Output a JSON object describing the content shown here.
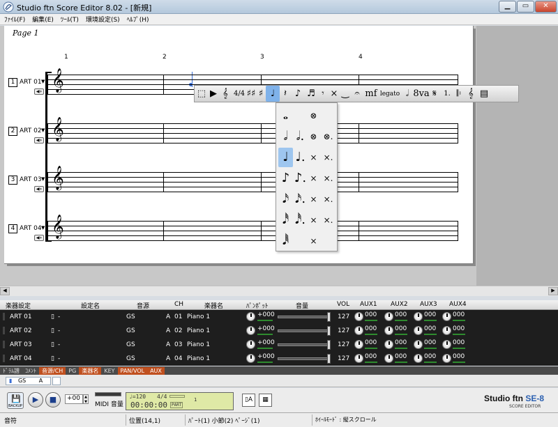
{
  "window": {
    "title": "Studio ftn Score Editor 8.02 - [新規]"
  },
  "menu": [
    "ﾌｧｲﾙ(F)",
    "編集(E)",
    "ﾂｰﾙ(T)",
    "環境設定(S)",
    "ﾍﾙﾌﾟ(H)"
  ],
  "score": {
    "page_label": "Page 1",
    "measures": [
      "1",
      "2",
      "3",
      "4"
    ],
    "tracks": [
      {
        "num": "1",
        "name": "ART 01"
      },
      {
        "num": "2",
        "name": "ART 02"
      },
      {
        "num": "3",
        "name": "ART 03"
      },
      {
        "num": "4",
        "name": "ART 04"
      }
    ]
  },
  "toolbar": {
    "tools": [
      {
        "name": "select-tool",
        "glyph": "⬚"
      },
      {
        "name": "play-tool",
        "glyph": "▶"
      },
      {
        "name": "clef-tool",
        "glyph": "𝄞"
      },
      {
        "name": "time-signature-tool",
        "glyph": "4/4"
      },
      {
        "name": "key-signature-tool",
        "glyph": "♯♯"
      },
      {
        "name": "accidental-tool",
        "glyph": "♯"
      },
      {
        "name": "note-tool",
        "glyph": "♩"
      },
      {
        "name": "rest-tool",
        "glyph": "𝄽"
      },
      {
        "name": "tuplet-tool",
        "glyph": "♪"
      },
      {
        "name": "tuplet-rest-tool",
        "glyph": "♬"
      },
      {
        "name": "grace-tool",
        "glyph": "𝄾"
      },
      {
        "name": "drum-tool",
        "glyph": "×"
      },
      {
        "name": "tie-tool",
        "glyph": "‿"
      },
      {
        "name": "fermata-tool",
        "glyph": "𝄐"
      },
      {
        "name": "dynamics-tool",
        "glyph": "mf"
      },
      {
        "name": "legato-tool",
        "glyph": "legato"
      },
      {
        "name": "repeat-dot-tool",
        "glyph": "𝅗𝅥"
      },
      {
        "name": "octave-tool",
        "glyph": "8va"
      },
      {
        "name": "segno-tool",
        "glyph": "𝄋"
      },
      {
        "name": "volta-tool",
        "glyph": "1."
      },
      {
        "name": "repeat-tool",
        "glyph": "𝄆"
      },
      {
        "name": "staff-tool",
        "glyph": "𝄞"
      },
      {
        "name": "layout-tool",
        "glyph": "▤"
      }
    ],
    "selected_tool": "note-tool"
  },
  "note_palette": {
    "rows": [
      [
        "𝅝",
        "",
        "⊗",
        ""
      ],
      [
        "𝅗𝅥",
        "𝅗𝅥.",
        "⊗",
        "⊗."
      ],
      [
        "♩",
        "♩.",
        "×",
        "×."
      ],
      [
        "♪",
        "♪.",
        "×",
        "×."
      ],
      [
        "𝅘𝅥𝅯",
        "𝅘𝅥𝅯.",
        "×",
        "×."
      ],
      [
        "𝅘𝅥𝅰",
        "𝅘𝅥𝅰.",
        "×",
        "×."
      ],
      [
        "𝅘𝅥𝅱",
        "",
        "×",
        ""
      ]
    ],
    "selected": "row2-col0"
  },
  "instrument_table": {
    "headers": [
      "楽器設定",
      "設定名",
      "音源",
      "CH",
      "楽器名",
      "ﾊﾟﾝﾎﾟｯﾄ",
      "音量",
      "VOL",
      "AUX1",
      "AUX2",
      "AUX3",
      "AUX4"
    ],
    "rows": [
      {
        "name": "ART 01",
        "setting": "-",
        "source": "GS",
        "port": "A",
        "ch": "01",
        "instrument": "Piano 1",
        "pan": "+000",
        "vol": "127",
        "aux1": "000",
        "aux2": "000",
        "aux3": "000",
        "aux4": "000"
      },
      {
        "name": "ART 02",
        "setting": "-",
        "source": "GS",
        "port": "A",
        "ch": "02",
        "instrument": "Piano 1",
        "pan": "+000",
        "vol": "127",
        "aux1": "000",
        "aux2": "000",
        "aux3": "000",
        "aux4": "000"
      },
      {
        "name": "ART 03",
        "setting": "-",
        "source": "GS",
        "port": "A",
        "ch": "03",
        "instrument": "Piano 1",
        "pan": "+000",
        "vol": "127",
        "aux1": "000",
        "aux2": "000",
        "aux3": "000",
        "aux4": "000"
      },
      {
        "name": "ART 04",
        "setting": "-",
        "source": "GS",
        "port": "A",
        "ch": "04",
        "instrument": "Piano 1",
        "pan": "+000",
        "vol": "127",
        "aux1": "000",
        "aux2": "000",
        "aux3": "000",
        "aux4": "000"
      }
    ]
  },
  "tabs": [
    "ﾄﾞﾗﾑ譜",
    "ｺﾒﾝﾄ",
    "音源/CH",
    "PG",
    "楽器名",
    "KEY",
    "PAN/VOL",
    "AUX"
  ],
  "tabs_active": [
    "音源/CH",
    "楽器名",
    "PAN/VOL",
    "AUX"
  ],
  "mini_strip": {
    "source": "GS",
    "port": "A"
  },
  "transport": {
    "backup_label": "BACKUP",
    "transpose": "+00",
    "midi_volume_label": "MIDI 音量",
    "tempo": "♩=120",
    "timesig": "4/4",
    "time": "00:00:00",
    "part_label": "PART",
    "part_num": "1"
  },
  "brand": {
    "name": "Studio ftn",
    "suffix": "SE-8",
    "sub": "SCORE EDITOR"
  },
  "status": {
    "left": "音符",
    "position": "位置(14,1)",
    "info": "ﾊﾟｰﾄ(1) 小節(2) ﾍﾟｰｼﾞ(1)",
    "wheel": "ﾎｲｰﾙﾓｰﾄﾞ : 縦スクロール"
  }
}
